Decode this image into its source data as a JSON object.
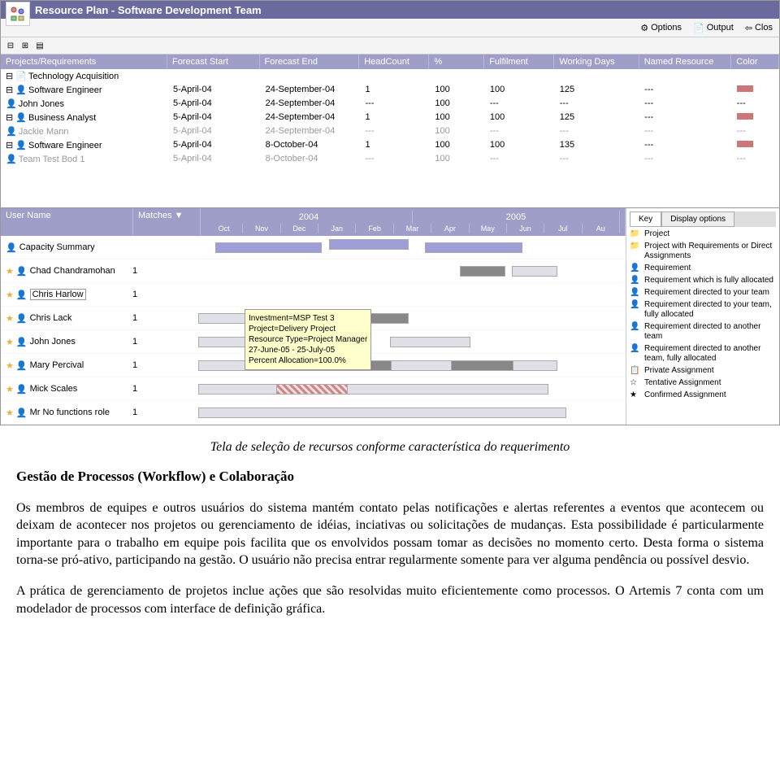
{
  "title": "Resource Plan - Software Development Team",
  "toolbar": {
    "options": "Options",
    "output": "Output",
    "close": "Clos"
  },
  "columns": {
    "proj": "Projects/Requirements",
    "fs": "Forecast Start",
    "fe": "Forecast End",
    "hc": "HeadCount",
    "pc": "%",
    "ful": "Fulfilment",
    "wd": "Working Days",
    "nr": "Named Resource",
    "col": "Color"
  },
  "rows": [
    {
      "lvl": 0,
      "name": "Technology Acquisition",
      "fs": "",
      "fe": "",
      "hc": "",
      "pc": "",
      "ful": "",
      "wd": "",
      "nr": "",
      "col": false
    },
    {
      "lvl": 1,
      "name": "Software Engineer",
      "fs": "5-April-04",
      "fe": "24-September-04",
      "hc": "1",
      "pc": "100",
      "ful": "100",
      "wd": "125",
      "nr": "---",
      "col": true
    },
    {
      "lvl": 2,
      "name": "John Jones",
      "fs": "5-April-04",
      "fe": "24-September-04",
      "hc": "---",
      "pc": "100",
      "ful": "---",
      "wd": "---",
      "nr": "---",
      "col": false
    },
    {
      "lvl": 1,
      "name": "Business Analyst",
      "fs": "5-April-04",
      "fe": "24-September-04",
      "hc": "1",
      "pc": "100",
      "ful": "100",
      "wd": "125",
      "nr": "---",
      "col": true
    },
    {
      "lvl": 2,
      "name": "Jackie Mann",
      "fs": "5-April-04",
      "fe": "24-September-04",
      "hc": "---",
      "pc": "100",
      "ful": "---",
      "wd": "---",
      "nr": "---",
      "col": false,
      "grey": true
    },
    {
      "lvl": 1,
      "name": "Software Engineer",
      "fs": "5-April-04",
      "fe": "8-October-04",
      "hc": "1",
      "pc": "100",
      "ful": "100",
      "wd": "135",
      "nr": "---",
      "col": true
    },
    {
      "lvl": 2,
      "name": "Team Test Bod 1",
      "fs": "5-April-04",
      "fe": "8-October-04",
      "hc": "---",
      "pc": "100",
      "ful": "---",
      "wd": "---",
      "nr": "---",
      "col": false,
      "grey": true
    }
  ],
  "lower_cols": {
    "un": "User Name",
    "mt": "Matches ▼"
  },
  "years": [
    "2004",
    "2005"
  ],
  "months": [
    "Oct",
    "Nov",
    "Dec",
    "Jan",
    "Feb",
    "Mar",
    "Apr",
    "May",
    "Jun",
    "Jul",
    "Au"
  ],
  "capacity_label": "Capacity Summary",
  "users": [
    {
      "name": "Chad Chandramohan",
      "m": "1"
    },
    {
      "name": "Chris Harlow",
      "m": "1",
      "boxed": true
    },
    {
      "name": "Chris Lack",
      "m": "1"
    },
    {
      "name": "John Jones",
      "m": "1"
    },
    {
      "name": "Mary Percival",
      "m": "1"
    },
    {
      "name": "Mick Scales",
      "m": "1"
    },
    {
      "name": "Mr No functions role",
      "m": "1"
    }
  ],
  "tooltip": {
    "l1": "Investment=MSP Test 3",
    "l2": "Project=Delivery Project",
    "l3": "Resource Type=Project Manager",
    "l4": "27-June-05 - 25-July-05",
    "l5": "Percent Allocation=100.0%"
  },
  "tabs": {
    "key": "Key",
    "disp": "Display options"
  },
  "key": [
    "Project",
    "Project with Requirements or Direct Assignments",
    "Requirement",
    "Requirement which is fully allocated",
    "Requirement directed to your team",
    "Requirement directed to your team, fully allocated",
    "Requirement directed to another team",
    "Requirement directed to another team, fully allocated",
    "Private Assignment",
    "Tentative Assignment",
    "Confirmed Assignment"
  ],
  "doc": {
    "caption": "Tela de seleção de recursos conforme característica do requerimento",
    "h1": "Gestão de Processos (Workflow) e Colaboração",
    "p1": "Os membros de equipes e outros usuários do sistema mantém contato pelas notificações e alertas referentes a eventos que acontecem ou deixam de acontecer nos projetos ou gerenciamento de idéias, inciativas ou solicitações de mudanças. Esta possibilidade é particularmente importante para o trabalho em equipe pois facilita que os envolvidos possam tomar as decisões no momento certo. Desta forma o sistema torna-se pró-ativo, participando na gestão. O usuário não precisa entrar regularmente somente para ver alguma pendência ou possível desvio.",
    "p2": "A prática de gerenciamento de projetos inclue ações que são resolvidas muito eficientemente como processos. O Artemis 7 conta com um modelador de processos com interface de definição gráfica."
  }
}
